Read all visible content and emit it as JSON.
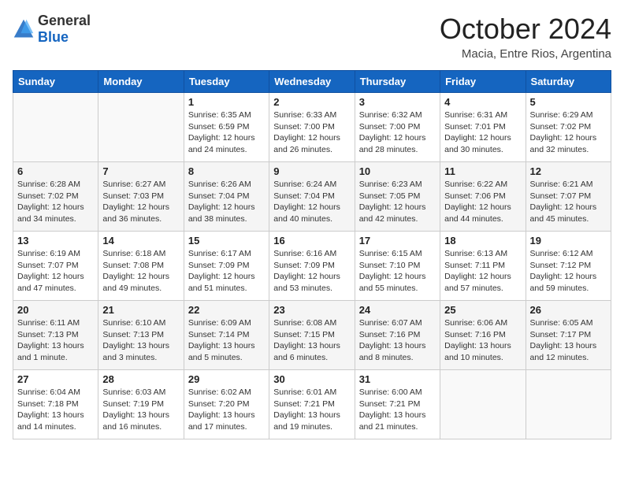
{
  "header": {
    "logo_general": "General",
    "logo_blue": "Blue",
    "month": "October 2024",
    "location": "Macia, Entre Rios, Argentina"
  },
  "weekdays": [
    "Sunday",
    "Monday",
    "Tuesday",
    "Wednesday",
    "Thursday",
    "Friday",
    "Saturday"
  ],
  "weeks": [
    [
      {
        "day": "",
        "sunrise": "",
        "sunset": "",
        "daylight": ""
      },
      {
        "day": "",
        "sunrise": "",
        "sunset": "",
        "daylight": ""
      },
      {
        "day": "1",
        "sunrise": "Sunrise: 6:35 AM",
        "sunset": "Sunset: 6:59 PM",
        "daylight": "Daylight: 12 hours and 24 minutes."
      },
      {
        "day": "2",
        "sunrise": "Sunrise: 6:33 AM",
        "sunset": "Sunset: 7:00 PM",
        "daylight": "Daylight: 12 hours and 26 minutes."
      },
      {
        "day": "3",
        "sunrise": "Sunrise: 6:32 AM",
        "sunset": "Sunset: 7:00 PM",
        "daylight": "Daylight: 12 hours and 28 minutes."
      },
      {
        "day": "4",
        "sunrise": "Sunrise: 6:31 AM",
        "sunset": "Sunset: 7:01 PM",
        "daylight": "Daylight: 12 hours and 30 minutes."
      },
      {
        "day": "5",
        "sunrise": "Sunrise: 6:29 AM",
        "sunset": "Sunset: 7:02 PM",
        "daylight": "Daylight: 12 hours and 32 minutes."
      }
    ],
    [
      {
        "day": "6",
        "sunrise": "Sunrise: 6:28 AM",
        "sunset": "Sunset: 7:02 PM",
        "daylight": "Daylight: 12 hours and 34 minutes."
      },
      {
        "day": "7",
        "sunrise": "Sunrise: 6:27 AM",
        "sunset": "Sunset: 7:03 PM",
        "daylight": "Daylight: 12 hours and 36 minutes."
      },
      {
        "day": "8",
        "sunrise": "Sunrise: 6:26 AM",
        "sunset": "Sunset: 7:04 PM",
        "daylight": "Daylight: 12 hours and 38 minutes."
      },
      {
        "day": "9",
        "sunrise": "Sunrise: 6:24 AM",
        "sunset": "Sunset: 7:04 PM",
        "daylight": "Daylight: 12 hours and 40 minutes."
      },
      {
        "day": "10",
        "sunrise": "Sunrise: 6:23 AM",
        "sunset": "Sunset: 7:05 PM",
        "daylight": "Daylight: 12 hours and 42 minutes."
      },
      {
        "day": "11",
        "sunrise": "Sunrise: 6:22 AM",
        "sunset": "Sunset: 7:06 PM",
        "daylight": "Daylight: 12 hours and 44 minutes."
      },
      {
        "day": "12",
        "sunrise": "Sunrise: 6:21 AM",
        "sunset": "Sunset: 7:07 PM",
        "daylight": "Daylight: 12 hours and 45 minutes."
      }
    ],
    [
      {
        "day": "13",
        "sunrise": "Sunrise: 6:19 AM",
        "sunset": "Sunset: 7:07 PM",
        "daylight": "Daylight: 12 hours and 47 minutes."
      },
      {
        "day": "14",
        "sunrise": "Sunrise: 6:18 AM",
        "sunset": "Sunset: 7:08 PM",
        "daylight": "Daylight: 12 hours and 49 minutes."
      },
      {
        "day": "15",
        "sunrise": "Sunrise: 6:17 AM",
        "sunset": "Sunset: 7:09 PM",
        "daylight": "Daylight: 12 hours and 51 minutes."
      },
      {
        "day": "16",
        "sunrise": "Sunrise: 6:16 AM",
        "sunset": "Sunset: 7:09 PM",
        "daylight": "Daylight: 12 hours and 53 minutes."
      },
      {
        "day": "17",
        "sunrise": "Sunrise: 6:15 AM",
        "sunset": "Sunset: 7:10 PM",
        "daylight": "Daylight: 12 hours and 55 minutes."
      },
      {
        "day": "18",
        "sunrise": "Sunrise: 6:13 AM",
        "sunset": "Sunset: 7:11 PM",
        "daylight": "Daylight: 12 hours and 57 minutes."
      },
      {
        "day": "19",
        "sunrise": "Sunrise: 6:12 AM",
        "sunset": "Sunset: 7:12 PM",
        "daylight": "Daylight: 12 hours and 59 minutes."
      }
    ],
    [
      {
        "day": "20",
        "sunrise": "Sunrise: 6:11 AM",
        "sunset": "Sunset: 7:13 PM",
        "daylight": "Daylight: 13 hours and 1 minute."
      },
      {
        "day": "21",
        "sunrise": "Sunrise: 6:10 AM",
        "sunset": "Sunset: 7:13 PM",
        "daylight": "Daylight: 13 hours and 3 minutes."
      },
      {
        "day": "22",
        "sunrise": "Sunrise: 6:09 AM",
        "sunset": "Sunset: 7:14 PM",
        "daylight": "Daylight: 13 hours and 5 minutes."
      },
      {
        "day": "23",
        "sunrise": "Sunrise: 6:08 AM",
        "sunset": "Sunset: 7:15 PM",
        "daylight": "Daylight: 13 hours and 6 minutes."
      },
      {
        "day": "24",
        "sunrise": "Sunrise: 6:07 AM",
        "sunset": "Sunset: 7:16 PM",
        "daylight": "Daylight: 13 hours and 8 minutes."
      },
      {
        "day": "25",
        "sunrise": "Sunrise: 6:06 AM",
        "sunset": "Sunset: 7:16 PM",
        "daylight": "Daylight: 13 hours and 10 minutes."
      },
      {
        "day": "26",
        "sunrise": "Sunrise: 6:05 AM",
        "sunset": "Sunset: 7:17 PM",
        "daylight": "Daylight: 13 hours and 12 minutes."
      }
    ],
    [
      {
        "day": "27",
        "sunrise": "Sunrise: 6:04 AM",
        "sunset": "Sunset: 7:18 PM",
        "daylight": "Daylight: 13 hours and 14 minutes."
      },
      {
        "day": "28",
        "sunrise": "Sunrise: 6:03 AM",
        "sunset": "Sunset: 7:19 PM",
        "daylight": "Daylight: 13 hours and 16 minutes."
      },
      {
        "day": "29",
        "sunrise": "Sunrise: 6:02 AM",
        "sunset": "Sunset: 7:20 PM",
        "daylight": "Daylight: 13 hours and 17 minutes."
      },
      {
        "day": "30",
        "sunrise": "Sunrise: 6:01 AM",
        "sunset": "Sunset: 7:21 PM",
        "daylight": "Daylight: 13 hours and 19 minutes."
      },
      {
        "day": "31",
        "sunrise": "Sunrise: 6:00 AM",
        "sunset": "Sunset: 7:21 PM",
        "daylight": "Daylight: 13 hours and 21 minutes."
      },
      {
        "day": "",
        "sunrise": "",
        "sunset": "",
        "daylight": ""
      },
      {
        "day": "",
        "sunrise": "",
        "sunset": "",
        "daylight": ""
      }
    ]
  ]
}
